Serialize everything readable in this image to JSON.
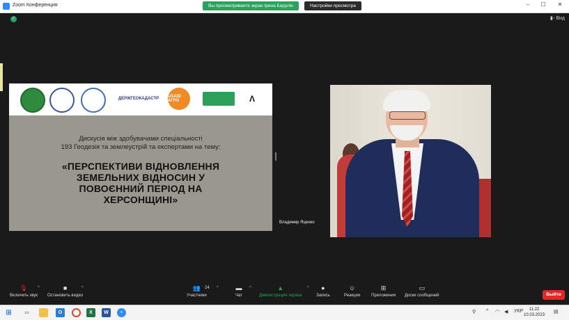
{
  "window": {
    "title": "Zoom Конференция",
    "share_banner": "Вы просматриваете экран Ірина Барулін",
    "view_settings": "Настройки просмотра",
    "controls": [
      "–",
      "☐",
      "✕"
    ]
  },
  "meeting": {
    "view_button": "Вид",
    "slide": {
      "logo_labels": [
        "",
        "",
        "",
        "ДЕРЖГЕОКАДАСТР",
        "USAID АГРО",
        "",
        "Λ"
      ],
      "subtitle_lines": [
        "Дискусія між здобувачами спеціальності",
        "193 Геодезія та землеустрій та експертами на тему:"
      ],
      "title_lines": [
        "«ПЕРСПЕКТИВИ ВІДНОВЛЕННЯ",
        "ЗЕМЕЛЬНИХ ВІДНОСИН У",
        "ПОВОЄННИЙ ПЕРІОД НА",
        "ХЕРСОНЩИНІ»"
      ]
    },
    "participant_name": "Владимир Яценко"
  },
  "toolbar": {
    "mute": "Включить звук",
    "stop_video": "Остановить видео",
    "participants": "Участники",
    "participants_count": "24",
    "chat": "Чат",
    "share_screen": "Демонстрация экрана",
    "record": "Запись",
    "reactions": "Реакции",
    "apps": "Приложения",
    "whiteboards": "Доски сообщений",
    "leave": "Выйти"
  },
  "taskbar": {
    "language": "УКР",
    "time": "11:22",
    "date": "10.03.2023"
  },
  "colors": {
    "share_banner": "#23a55a",
    "leave_button": "#e02828",
    "share_screen_icon": "#23a55a"
  }
}
